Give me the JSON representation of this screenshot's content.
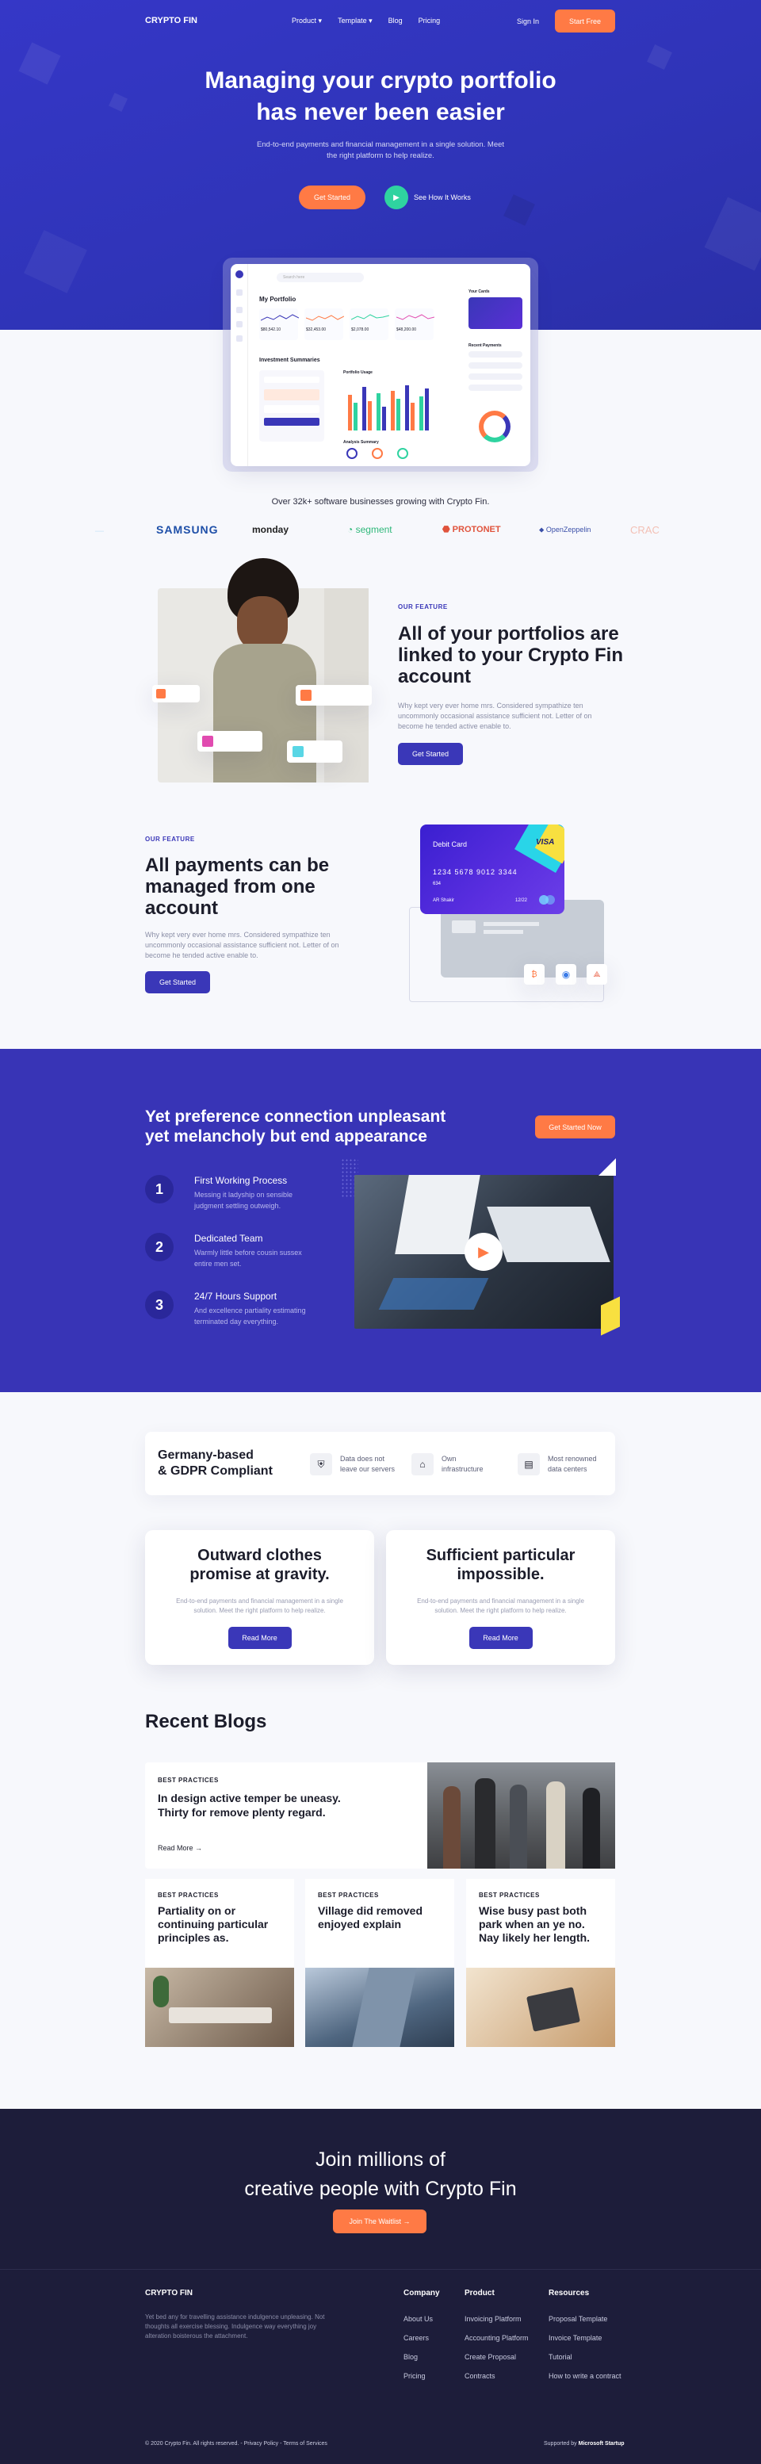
{
  "brand": "CRYPTO FIN",
  "nav": {
    "items": [
      "Product",
      "Template",
      "Blog",
      "Pricing"
    ],
    "signin": "Sign In",
    "cta": "Start Free"
  },
  "hero": {
    "title_l1": "Managing your crypto portfolio",
    "title_l2": "has never been easier",
    "sub_l1": "End-to-end payments and financial management in a single solution. Meet",
    "sub_l2": "the right platform to help realize.",
    "get_started": "Get Started",
    "how": "See How It Works"
  },
  "dashboard": {
    "search": "Search here",
    "portfolio": "My Portfolio",
    "values": [
      "$80,542.10",
      "$32,453.00",
      "$2,078.00",
      "$48,200.00"
    ],
    "invest": "Investment Summaries",
    "portfolio_usage": "Portfolio Usage",
    "your_cards": "Your Cards",
    "recent": "Recent Payments",
    "analysis": "Analysis Summary"
  },
  "trust": {
    "text": "Over 32k+ software businesses growing with Crypto Fin.",
    "logos": [
      "SAMSUNG",
      "monday",
      "segment",
      "PROTONET",
      "OpenZeppelin"
    ]
  },
  "feature1": {
    "eyebrow": "OUR FEATURE",
    "title_l1": "All of your portfolios are",
    "title_l2": "linked to your Crypto Fin",
    "title_l3": "account",
    "body_l1": "Why kept very ever home mrs. Considered sympathize ten",
    "body_l2": "uncommonly occasional assistance sufficient not. Letter of on",
    "body_l3": "become he tended active enable to.",
    "btn": "Get Started"
  },
  "feature2": {
    "eyebrow": "OUR FEATURE",
    "title_l1": "All payments can be",
    "title_l2": "managed from one",
    "title_l3": "account",
    "body_l1": "Why kept very ever home mrs. Considered sympathize ten",
    "body_l2": "uncommonly occasional assistance sufficient not. Letter of on",
    "body_l3": "become he tended active enable to.",
    "btn": "Get Started",
    "card_label": "Debit Card",
    "card_brand": "VISA",
    "card_number": "1234  5678  9012  3344",
    "card_cvv": "634",
    "card_holder": "AR Shakir",
    "card_exp": "12/22"
  },
  "process": {
    "title_l1": "Yet preference connection unpleasant",
    "title_l2": "yet melancholy but end appearance",
    "cta": "Get Started Now",
    "steps": [
      {
        "num": "1",
        "title": "First Working Process",
        "l1": "Messing it ladyship on sensible",
        "l2": "judgment settling outweigh."
      },
      {
        "num": "2",
        "title": "Dedicated Team",
        "l1": "Warmly little before cousin sussex",
        "l2": "entire men set."
      },
      {
        "num": "3",
        "title": "24/7 Hours Support",
        "l1": "And excellence partiality estimating",
        "l2": "terminated day everything."
      }
    ]
  },
  "gdpr": {
    "title_l1": "Germany-based",
    "title_l2": "& GDPR Compliant",
    "items": [
      {
        "l1": "Data does not",
        "l2": "leave our servers"
      },
      {
        "l1": "Own",
        "l2": "infrastructure"
      },
      {
        "l1": "Most renowned",
        "l2": "data centers"
      }
    ]
  },
  "promo": [
    {
      "t1": "Outward clothes",
      "t2": "promise at gravity.",
      "b1": "End-to-end payments and financial management in a single",
      "b2": "solution. Meet the right platform to help realize.",
      "btn": "Read More"
    },
    {
      "t1": "Sufficient particular",
      "t2": "impossible.",
      "b1": "End-to-end payments and financial management in a single",
      "b2": "solution. Meet the right platform to help realize.",
      "btn": "Read More"
    }
  ],
  "blogs": {
    "heading": "Recent Blogs",
    "featured": {
      "tag": "BEST PRACTICES",
      "t1": "In design active temper be uneasy.",
      "t2": "Thirty for remove plenty regard.",
      "more": "Read More"
    },
    "posts": [
      {
        "tag": "BEST PRACTICES",
        "t1": "Partiality on or",
        "t2": "continuing particular",
        "t3": "principles as."
      },
      {
        "tag": "BEST PRACTICES",
        "t1": "Village did removed",
        "t2": "enjoyed explain",
        "t3": ""
      },
      {
        "tag": "BEST PRACTICES",
        "t1": "Wise busy past both",
        "t2": "park when an ye no.",
        "t3": "Nay likely her length."
      }
    ]
  },
  "join": {
    "l1": "Join millions of",
    "l2": "creative people with Crypto Fin",
    "btn": "Join The Waitlist"
  },
  "footer": {
    "brand": "CRYPTO FIN",
    "desc_l1": "Yet bed any for travelling assistance indulgence unpleasing. Not",
    "desc_l2": "thoughts all exercise blessing. Indulgence way everything joy",
    "desc_l3": "alteration boisterous the attachment.",
    "cols": [
      {
        "title": "Company",
        "items": [
          "About Us",
          "Careers",
          "Blog",
          "Pricing"
        ]
      },
      {
        "title": "Product",
        "items": [
          "Invoicing Platform",
          "Accounting Platform",
          "Create Proposal",
          "Contracts"
        ]
      },
      {
        "title": "Resources",
        "items": [
          "Proposal Template",
          "Invoice Template",
          "Tutorial",
          "How to write a contract"
        ]
      }
    ],
    "copyright": "© 2020 Crypto Fin. All rights reserved.",
    "privacy": "Privacy Policy",
    "terms": "Terms of Services",
    "supported": "Supported by",
    "supporter": "Microsoft Startup"
  },
  "colors": {
    "primary": "#3a37b8",
    "accent": "#ff7a45",
    "dark": "#1d1d3a"
  }
}
